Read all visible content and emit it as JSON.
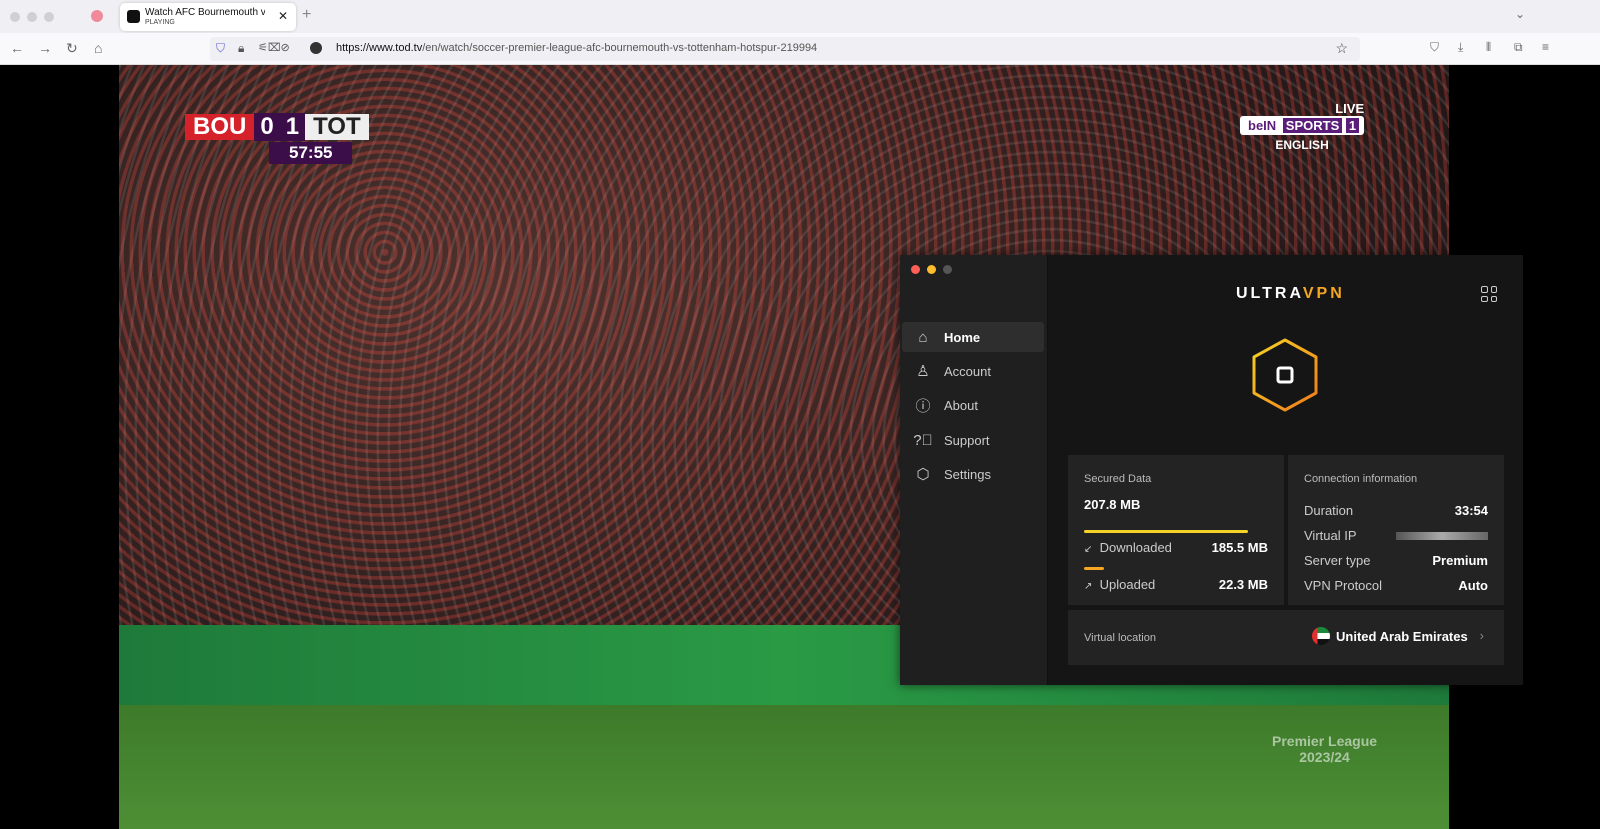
{
  "browser": {
    "tab_title": "Watch AFC Bournemouth vs Tottenham",
    "tab_status": "PLAYING",
    "url_domain": "https://www.tod.tv",
    "url_path": "/en/watch/soccer-premier-league-afc-bournemouth-vs-tottenham-hotspur-219994"
  },
  "video": {
    "home_team": "BOU",
    "home_score": "0",
    "away_score": "1",
    "away_team": "TOT",
    "clock": "57:55",
    "live": "LIVE",
    "channel_a": "beIN",
    "channel_b": "SPORTS",
    "channel_num": "1",
    "language": "ENGLISH",
    "watermark_1": "Premier League",
    "watermark_2": "2023/24"
  },
  "vpn": {
    "brand_a": "ULTRA",
    "brand_b": "VPN",
    "nav": [
      {
        "label": "Home",
        "icon": "home-icon"
      },
      {
        "label": "Account",
        "icon": "user-icon"
      },
      {
        "label": "About",
        "icon": "info-icon"
      },
      {
        "label": "Support",
        "icon": "help-icon"
      },
      {
        "label": "Settings",
        "icon": "settings-icon"
      }
    ],
    "secured": {
      "title": "Secured Data",
      "total": "207.8 MB",
      "downloaded_label": "Downloaded",
      "downloaded": "185.5 MB",
      "uploaded_label": "Uploaded",
      "uploaded": "22.3 MB",
      "download_fraction": 0.89,
      "upload_fraction": 0.11
    },
    "connection": {
      "title": "Connection information",
      "rows": [
        {
          "label": "Duration",
          "value": "33:54"
        },
        {
          "label": "Virtual IP",
          "value": ""
        },
        {
          "label": "Server type",
          "value": "Premium"
        },
        {
          "label": "VPN Protocol",
          "value": "Auto"
        }
      ]
    },
    "location": {
      "label": "Virtual location",
      "country": "United Arab Emirates"
    },
    "colors": {
      "accent_yellow": "#f5d327",
      "accent_orange": "#f5a623"
    }
  }
}
